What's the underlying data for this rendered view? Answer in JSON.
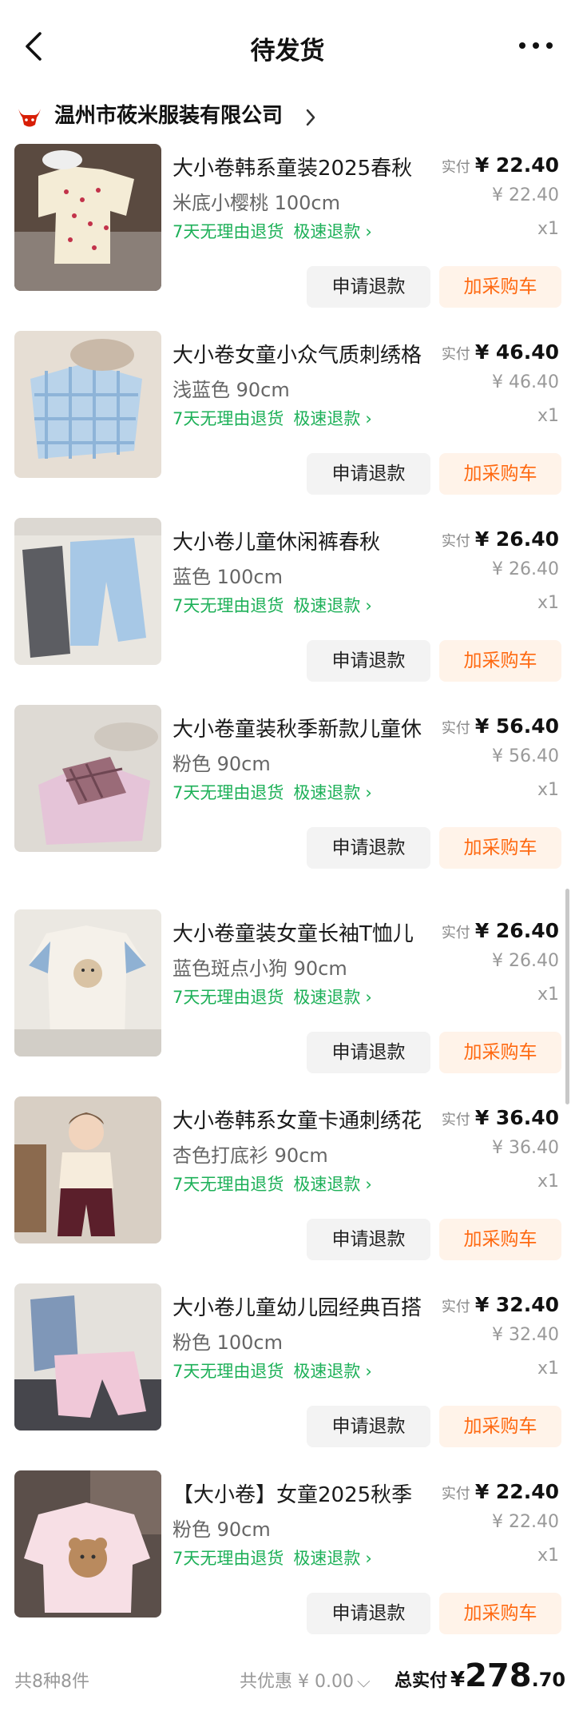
{
  "nav": {
    "title": "待发货"
  },
  "shop": {
    "name": "温州市莜米服装有限公司"
  },
  "labels": {
    "paid_label": "实付",
    "return_policy": "7天无理由退货",
    "fast_refund": "极速退款",
    "refund_button": "申请退款",
    "cart_button": "加采购车"
  },
  "items": [
    {
      "name": "大小卷韩系童装2025春秋",
      "spec": "米底小樱桃 100cm",
      "paid": "¥ 22.40",
      "original": "¥ 22.40",
      "qty": "x1"
    },
    {
      "name": "大小卷女童小众气质刺绣格",
      "spec": "浅蓝色 90cm",
      "paid": "¥ 46.40",
      "original": "¥ 46.40",
      "qty": "x1"
    },
    {
      "name": "大小卷儿童休闲裤春秋",
      "spec": "蓝色 100cm",
      "paid": "¥ 26.40",
      "original": "¥ 26.40",
      "qty": "x1"
    },
    {
      "name": "大小卷童装秋季新款儿童休",
      "spec": "粉色 90cm",
      "paid": "¥ 56.40",
      "original": "¥ 56.40",
      "qty": "x1"
    },
    {
      "name": "大小卷童装女童长袖T恤儿",
      "spec": "蓝色斑点小狗 90cm",
      "paid": "¥ 26.40",
      "original": "¥ 26.40",
      "qty": "x1"
    },
    {
      "name": "大小卷韩系女童卡通刺绣花",
      "spec": "杏色打底衫 90cm",
      "paid": "¥ 36.40",
      "original": "¥ 36.40",
      "qty": "x1"
    },
    {
      "name": "大小卷儿童幼儿园经典百搭",
      "spec": "粉色 100cm",
      "paid": "¥ 32.40",
      "original": "¥ 32.40",
      "qty": "x1"
    },
    {
      "name": "【大小卷】女童2025秋季",
      "spec": "粉色 90cm",
      "paid": "¥ 22.40",
      "original": "¥ 22.40",
      "qty": "x1"
    }
  ],
  "footer": {
    "count": "共8种8件",
    "discount": "共优惠 ¥ 0.00",
    "total_label": "总实付",
    "total_currency": "¥",
    "total_int": "278",
    "total_dec": ".70"
  },
  "icons": [
    "back-arrow-icon",
    "more-dots-icon",
    "shop-bull-logo-icon",
    "chevron-right-icon",
    "chevron-down-icon"
  ],
  "colors": {
    "service_green": "#1db058",
    "cart_orange": "#ff6a12",
    "cart_bg": "#fff3e9",
    "refund_bg": "#f3f3f3"
  }
}
